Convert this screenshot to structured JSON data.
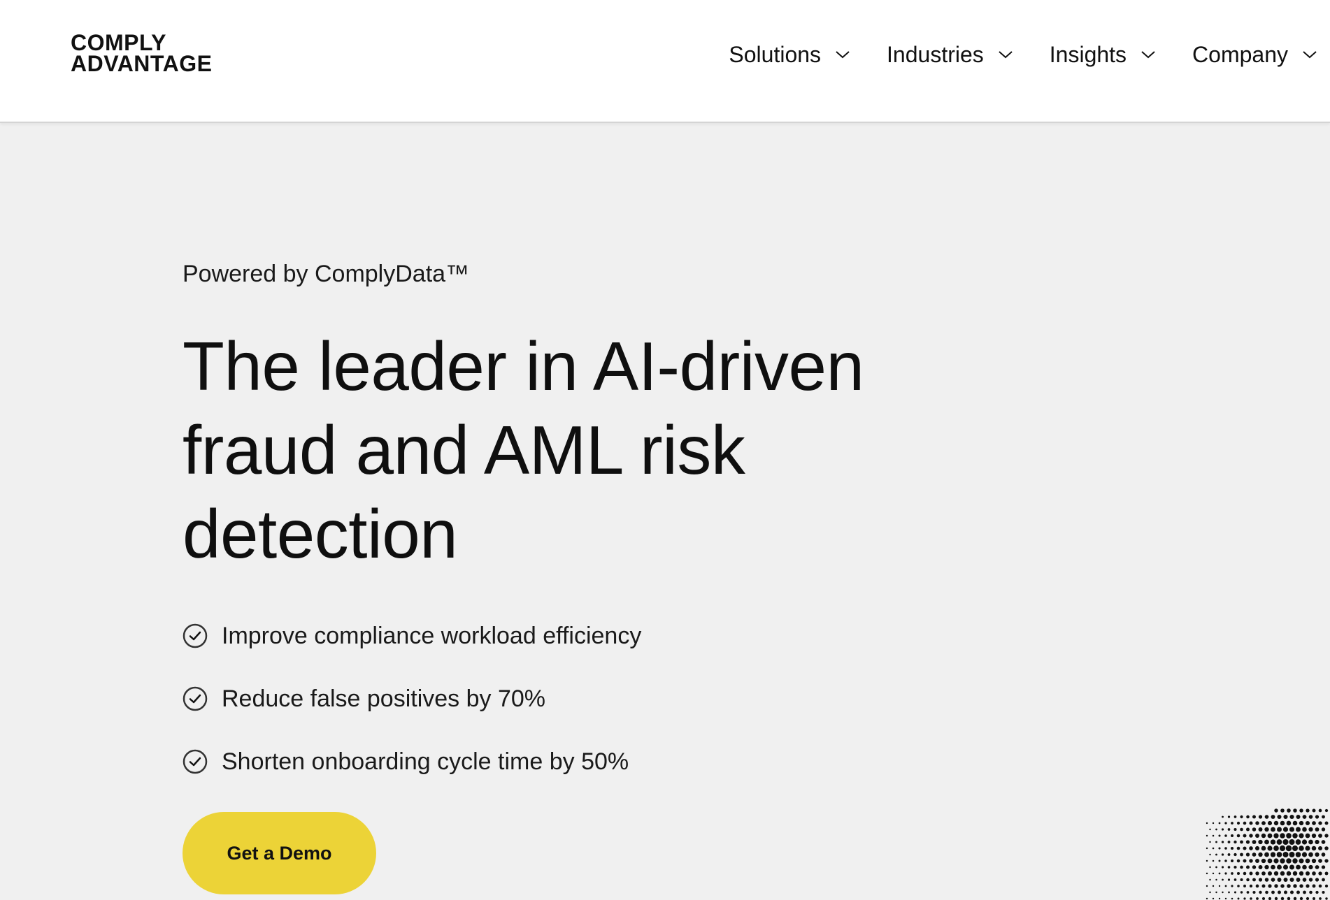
{
  "header": {
    "logo_line1": "COMPLY",
    "logo_line2": "ADVANTAGE",
    "nav": [
      {
        "label": "Solutions",
        "icon": "chevron-down-icon"
      },
      {
        "label": "Industries",
        "icon": "chevron-down-icon"
      },
      {
        "label": "Insights",
        "icon": "chevron-down-icon"
      },
      {
        "label": "Company",
        "icon": "chevron-down-icon"
      }
    ]
  },
  "hero": {
    "eyebrow": "Powered by ComplyData™",
    "headline": "The leader in AI-driven fraud and AML risk detection",
    "benefits": [
      {
        "text": "Improve compliance workload efficiency",
        "icon": "check-circle-icon"
      },
      {
        "text": "Reduce false positives by 70%",
        "icon": "check-circle-icon"
      },
      {
        "text": "Shorten onboarding cycle time by 50%",
        "icon": "check-circle-icon"
      }
    ],
    "cta_label": "Get a Demo"
  },
  "colors": {
    "background": "#f0f0f0",
    "header_background": "#ffffff",
    "cta_background": "#ecd337",
    "text": "#111111"
  }
}
